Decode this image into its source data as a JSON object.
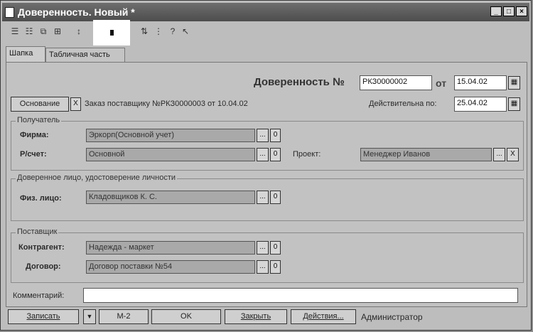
{
  "window": {
    "title": "Доверенность. Новый *",
    "min": "_",
    "max": "□",
    "close": "×"
  },
  "toolbar": {
    "icons": [
      "list-icon",
      "list-edit-icon",
      "copy-icon",
      "tree-icon",
      "arrow-icon",
      "filter-icon",
      "sort-icon",
      "tree-expand-icon",
      "help-icon",
      "pointer-help-icon"
    ]
  },
  "tabs": [
    {
      "label": "Шапка"
    },
    {
      "label": "Табличная часть"
    }
  ],
  "doc": {
    "heading": "Доверенность №",
    "number": "РКЗ0000002",
    "from_label": "от",
    "date": "15.04.02",
    "valid_label": "Действительна по:",
    "valid_date": "25.04.02"
  },
  "basis": {
    "button": "Основание",
    "clear": "X",
    "text": "Заказ поставщику №РКЗ0000003 от 10.04.02"
  },
  "recipient": {
    "title": "Получатель",
    "firm_label": "Фирма:",
    "firm_value": "Эркорп(Основной учет)",
    "account_label": "Р/счет:",
    "account_value": "Основной",
    "project_label": "Проект:",
    "project_value": "Менеджер Иванов"
  },
  "trusted": {
    "title": "Доверенное лицо, удостоверение личности",
    "person_label": "Физ. лицо:",
    "person_value": "Кладовщиков К. С."
  },
  "supplier": {
    "title": "Поставщик",
    "contractor_label": "Контрагент:",
    "contractor_value": "Надежда - маркет",
    "contract_label": "Договор:",
    "contract_value": "Договор поставки №54"
  },
  "comment": {
    "label": "Комментарий:",
    "value": ""
  },
  "buttons": {
    "save": "Записать",
    "dropdown": "▼",
    "m2": "М-2",
    "ok": "OK",
    "close": "Закрыть",
    "actions": "Действия...",
    "user": "Администратор"
  },
  "glyphs": {
    "select": "...",
    "zero": "0",
    "clear": "X",
    "calendar": "▦"
  }
}
